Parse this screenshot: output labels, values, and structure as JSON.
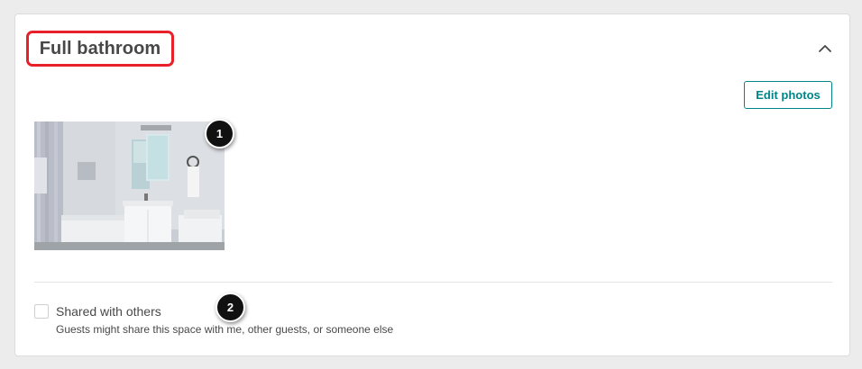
{
  "section": {
    "title": "Full bathroom",
    "collapse_icon": "chevron-up-icon",
    "edit_photos_label": "Edit photos"
  },
  "photos": [
    {
      "alt_icon": "bathroom-photo"
    }
  ],
  "callouts": [
    "1",
    "2"
  ],
  "shared": {
    "label": "Shared with others",
    "help_text": "Guests might share this space with me, other guests, or someone else",
    "checked": false
  },
  "colors": {
    "accent": "#008489",
    "highlight_border": "#e8202a",
    "text": "#484848"
  }
}
